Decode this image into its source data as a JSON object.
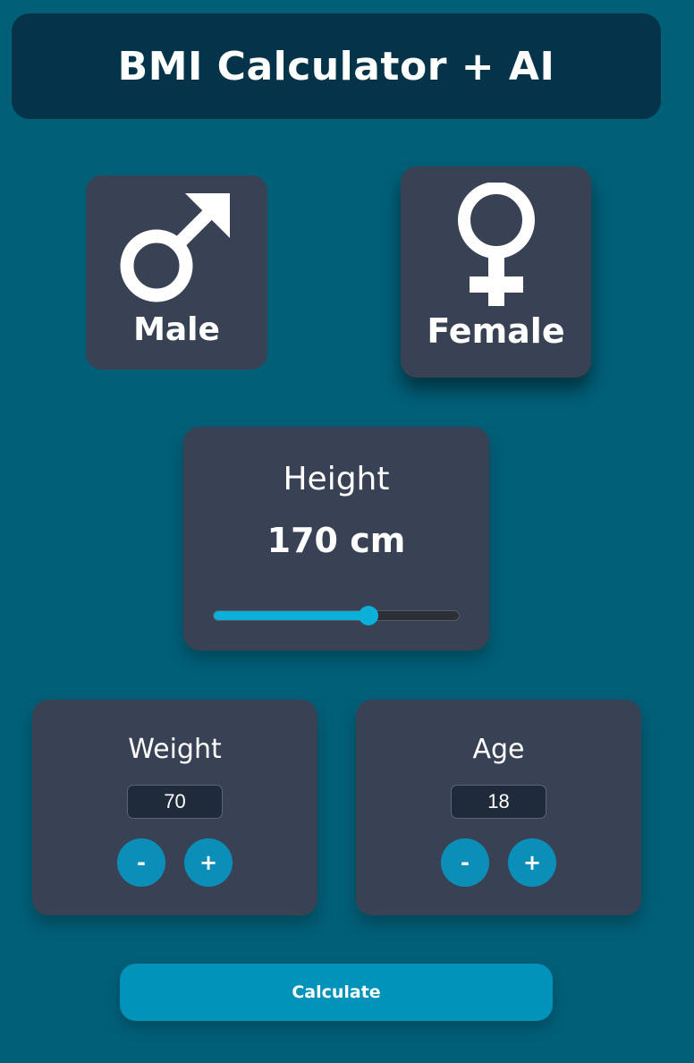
{
  "header": {
    "title": "BMI Calculator + AI"
  },
  "gender": {
    "male": {
      "label": "Male",
      "icon": "male-symbol-icon"
    },
    "female": {
      "label": "Female",
      "icon": "female-symbol-icon",
      "selected": true
    }
  },
  "height": {
    "title": "Height",
    "value_label": "170 cm",
    "value": 170,
    "slider_fraction": 0.63
  },
  "weight": {
    "title": "Weight",
    "value": "70",
    "minus_label": "-",
    "plus_label": "+"
  },
  "age": {
    "title": "Age",
    "value": "18",
    "minus_label": "-",
    "plus_label": "+"
  },
  "calculate": {
    "label": "Calculate"
  },
  "colors": {
    "background": "#015f78",
    "header": "#04334a",
    "card": "#394254",
    "accent": "#0ab0da",
    "button": "#0b8fb9"
  }
}
